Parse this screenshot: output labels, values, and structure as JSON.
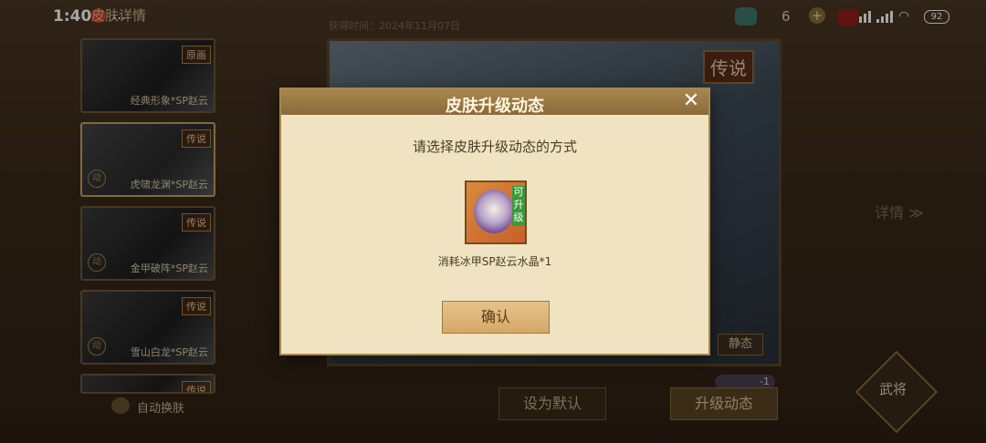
{
  "status": {
    "time": "1:40",
    "dots": "...",
    "battery": "92"
  },
  "header": {
    "title": "皮肤详情",
    "gem_count": "6",
    "plus": "+"
  },
  "skins": [
    {
      "name": "经典形象*SP赵云",
      "tier": "原画"
    },
    {
      "name": "虎啸龙渊*SP赵云",
      "tier": "传说",
      "badge": "动"
    },
    {
      "name": "金甲破阵*SP赵云",
      "tier": "传说",
      "badge": "动"
    },
    {
      "name": "雪山白龙*SP赵云",
      "tier": "传说",
      "badge": "动"
    },
    {
      "name": "",
      "tier": "传说"
    }
  ],
  "auto_switch": "自动换肤",
  "preview": {
    "date": "获得时间：2024年11月07日",
    "legend": "传说",
    "static": "静态",
    "detail": "详情 ≫"
  },
  "actions": {
    "set_default": "设为默认",
    "upgrade": "升级动态",
    "cost": "-1",
    "general": "武将"
  },
  "dialog": {
    "title": "皮肤升级动态",
    "close": "✕",
    "subtitle": "请选择皮肤升级动态的方式",
    "upgradable": "可升级",
    "item_desc": "消耗冰甲SP赵云水晶*1",
    "confirm": "确认"
  },
  "colors": {
    "accent": "#a8874e",
    "dialog_bg": "#f0e3c2",
    "confirm": "#d6a867"
  }
}
